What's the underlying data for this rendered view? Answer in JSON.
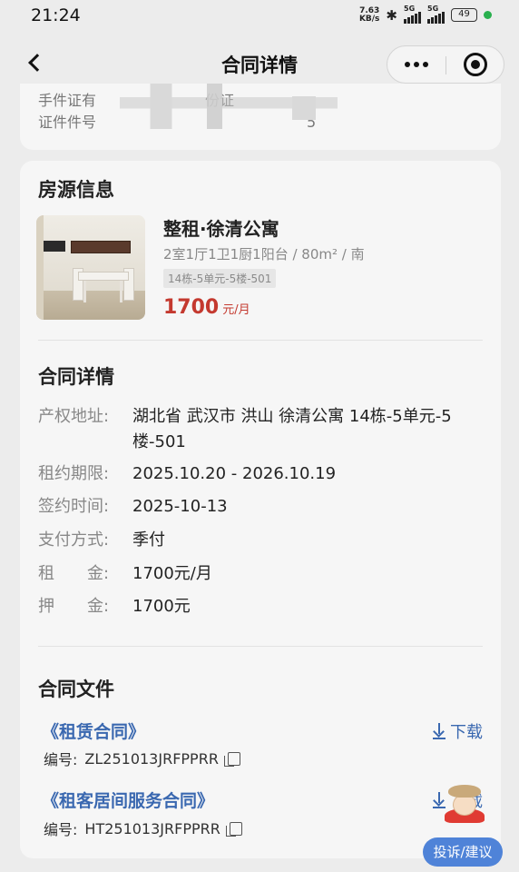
{
  "status_bar": {
    "time": "21:24",
    "net_speed_value": "7.63",
    "net_speed_unit": "KB/s",
    "sim1": "5G",
    "sim2": "5G",
    "battery": "49",
    "accent_green": "#29b04e"
  },
  "nav": {
    "title": "合同详情",
    "back_icon": "chevron-left-icon",
    "more_icon": "more-dots-icon",
    "close_icon": "target-close-icon"
  },
  "id_card": {
    "type_label": "手件证有",
    "type_value_partial": "份证",
    "number_label": "证件件号",
    "number_value_partial": "5"
  },
  "property": {
    "section_title": "房源信息",
    "name": "整租·徐清公寓",
    "meta": "2室1厅1卫1厨1阳台 / 80m² / 南",
    "room": "14栋-5单元-5楼-501",
    "price": "1700",
    "price_unit": "元/月",
    "price_color": "#c4392f"
  },
  "contract": {
    "section_title": "合同详情",
    "rows": [
      {
        "label": "产权地址:",
        "value": "湖北省 武汉市 洪山 徐清公寓 14栋-5单元-5",
        "value2": "楼-501"
      },
      {
        "label": "租约期限:",
        "value": "2025.10.20 - 2026.10.19"
      },
      {
        "label": "签约时间:",
        "value": "2025-10-13"
      },
      {
        "label": "支付方式:",
        "value": "季付"
      },
      {
        "label": "租　　金:",
        "value": "1700元/月"
      },
      {
        "label": "押　　金:",
        "value": "1700元"
      }
    ]
  },
  "files": {
    "section_title": "合同文件",
    "download_label": "下载",
    "number_prefix": "编号:",
    "items": [
      {
        "name": "《租赁合同》",
        "number": "ZL251013JRFPPRR"
      },
      {
        "name": "《租客居间服务合同》",
        "number": "HT251013JRFPPRR"
      }
    ],
    "link_color": "#3a68b0"
  },
  "float": {
    "complain_label": "投诉/建议",
    "button_color": "#4f83d8"
  }
}
